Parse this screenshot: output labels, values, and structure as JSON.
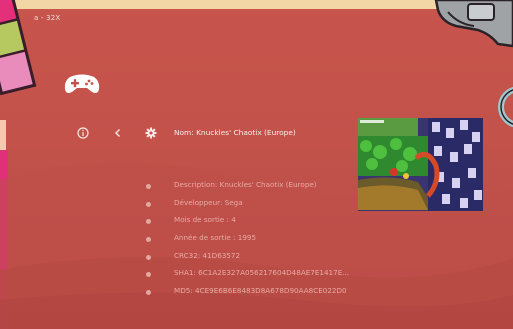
{
  "header": {
    "system_title": "a - 32X"
  },
  "toolbar": {
    "info_icon": "info-icon",
    "back_icon": "chevron-left-icon",
    "settings_icon": "gear-icon"
  },
  "game": {
    "name_line": "Nom: Knuckles' Chaotix (Europe)",
    "details": [
      "Description: Knuckles' Chaotix (Europe)",
      "Développeur: Sega",
      "Mois de sortie : 4",
      "Année de sortie : 1995",
      "CRC32: 41D63572",
      "SHA1: 6C1A2E327A056217604D48AE7E1417E...",
      "MD5: 4CE9E6B6E8483D8A678D90AA8CE022D0"
    ]
  },
  "colors": {
    "background": "#c2524a",
    "accent_pink": "#e0307a",
    "top_band": "#f2d6a6"
  }
}
